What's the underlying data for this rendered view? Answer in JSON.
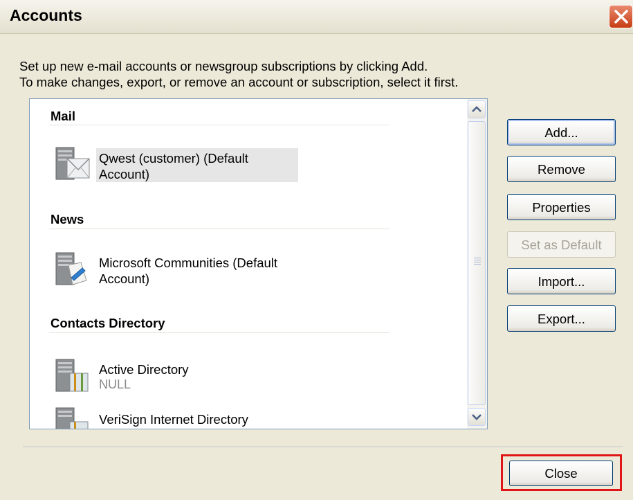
{
  "window": {
    "title": "Accounts"
  },
  "instructions": [
    "Set up new e-mail accounts or newsgroup subscriptions by clicking Add.",
    "To make changes, export, or remove an account or subscription, select it first."
  ],
  "groups": [
    {
      "header": "Mail",
      "items": [
        {
          "name": "Qwest (customer) (Default Account)",
          "icon": "mail-server-icon",
          "selected": true
        }
      ]
    },
    {
      "header": "News",
      "items": [
        {
          "name": "Microsoft Communities (Default Account)",
          "icon": "news-server-icon"
        }
      ]
    },
    {
      "header": "Contacts Directory",
      "items": [
        {
          "name": "Active Directory",
          "sub": "NULL",
          "icon": "directory-server-icon"
        },
        {
          "name": "VeriSign Internet Directory",
          "icon": "directory-server-icon"
        }
      ]
    }
  ],
  "buttons": {
    "add": "Add...",
    "remove": "Remove",
    "properties": "Properties",
    "set_default": "Set as Default",
    "import": "Import...",
    "export": "Export...",
    "close": "Close"
  },
  "colors": {
    "title_close": "#c63d13",
    "highlight": "#e01616",
    "button_border": "#003c74"
  }
}
